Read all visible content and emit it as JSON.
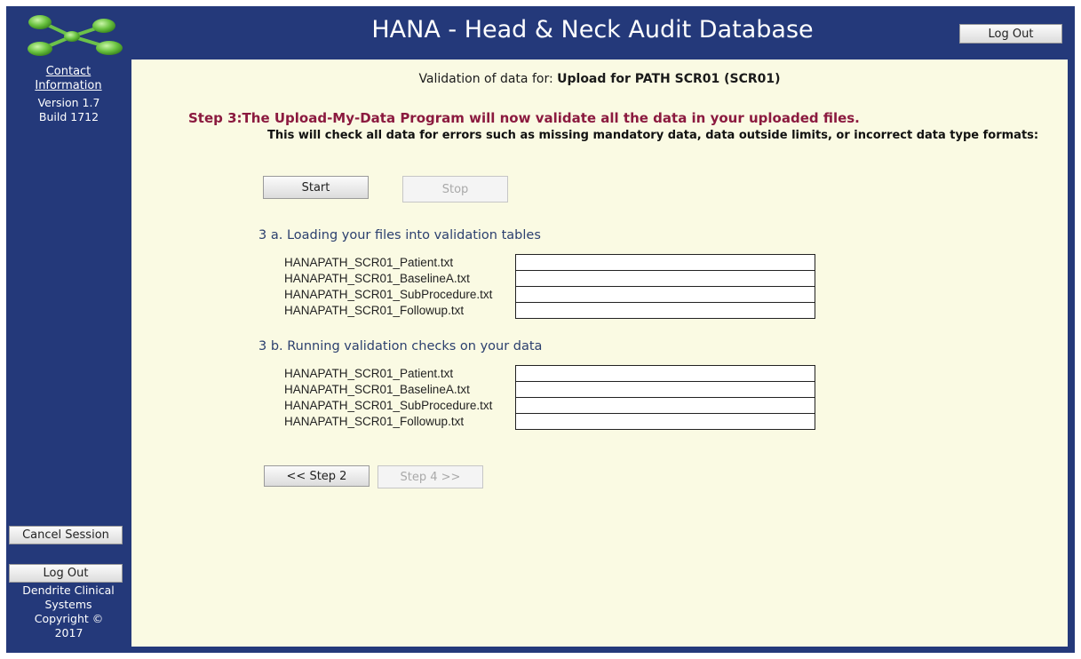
{
  "header": {
    "title": "HANA - Head & Neck Audit Database",
    "logout_label": "Log Out",
    "logo_icon": "molecule-logo-icon"
  },
  "sidebar": {
    "contact_label": "Contact Information",
    "version": "Version 1.7",
    "build": "Build 1712",
    "cancel_label": "Cancel Session",
    "logout_label": "Log Out",
    "company": "Dendrite Clinical Systems",
    "copyright": "Copyright ©",
    "year": "2017"
  },
  "main": {
    "validation_prefix": "Validation of data for:",
    "validation_target": "Upload for PATH SCR01 (SCR01)",
    "step_title": "Step 3:The Upload-My-Data Program will now validate all the data in your uploaded files.",
    "step_desc": "This will check all data for errors such as missing mandatory data, data outside limits, or incorrect data type formats:",
    "start_label": "Start",
    "stop_label": "Stop",
    "section_a": "3 a. Loading your files into validation tables",
    "section_b": "3 b. Running validation checks on your data",
    "files_a": [
      "HANAPATH_SCR01_Patient.txt",
      "HANAPATH_SCR01_BaselineA.txt",
      "HANAPATH_SCR01_SubProcedure.txt",
      "HANAPATH_SCR01_Followup.txt"
    ],
    "files_b": [
      "HANAPATH_SCR01_Patient.txt",
      "HANAPATH_SCR01_BaselineA.txt",
      "HANAPATH_SCR01_SubProcedure.txt",
      "HANAPATH_SCR01_Followup.txt"
    ],
    "prev_label": "<< Step 2",
    "next_label": "Step 4 >>"
  },
  "colors": {
    "frame": "#24397a",
    "content_bg": "#fafae3",
    "step_title": "#8b1a3f",
    "logo_green": "#6cc24a"
  }
}
